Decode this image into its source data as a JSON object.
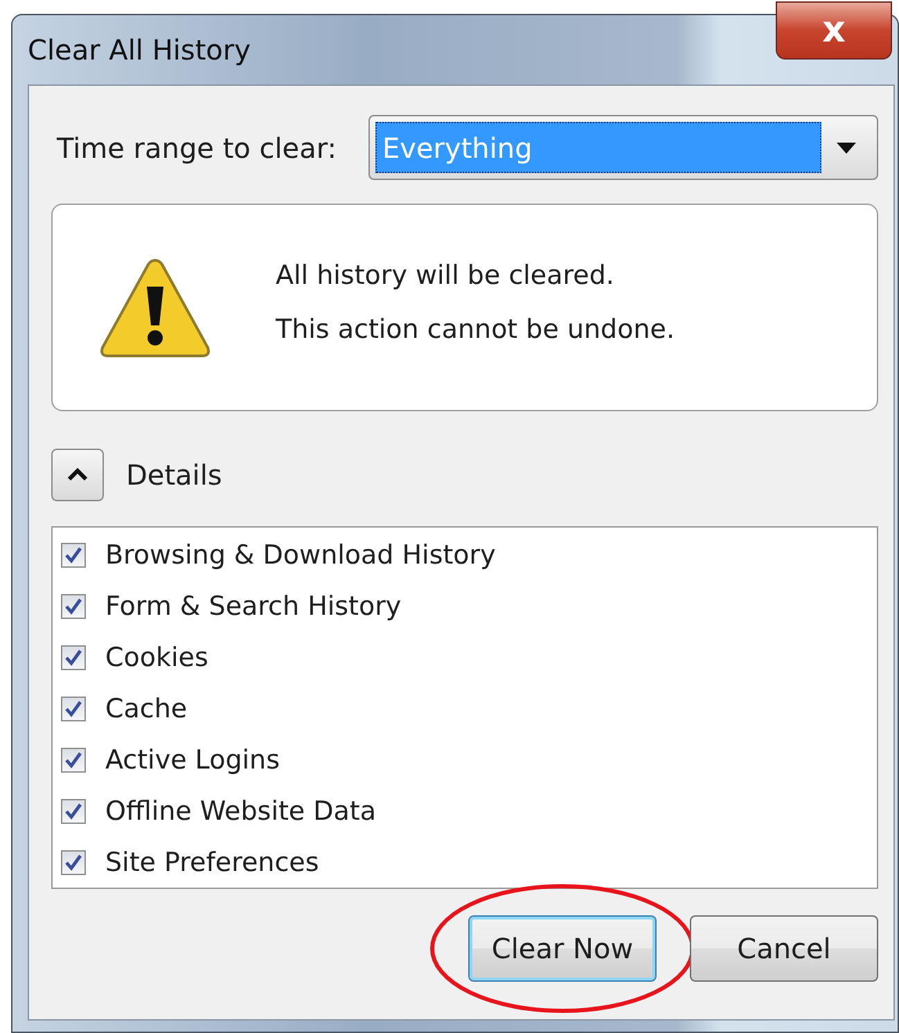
{
  "window": {
    "title": "Clear All History",
    "close_icon": "x"
  },
  "time_range": {
    "label": "Time range to clear:",
    "value": "Everything"
  },
  "warning": {
    "lines": [
      "All history will be cleared.",
      "This action cannot be undone."
    ]
  },
  "details": {
    "label": "Details",
    "expanded": true
  },
  "items": [
    {
      "label": "Browsing & Download History",
      "checked": true
    },
    {
      "label": "Form & Search History",
      "checked": true
    },
    {
      "label": "Cookies",
      "checked": true
    },
    {
      "label": "Cache",
      "checked": true
    },
    {
      "label": "Active Logins",
      "checked": true
    },
    {
      "label": "Offline Website Data",
      "checked": true
    },
    {
      "label": "Site Preferences",
      "checked": true
    }
  ],
  "buttons": [
    {
      "label": "Clear Now",
      "circled": true
    },
    {
      "label": "Cancel",
      "circled": false
    }
  ]
}
